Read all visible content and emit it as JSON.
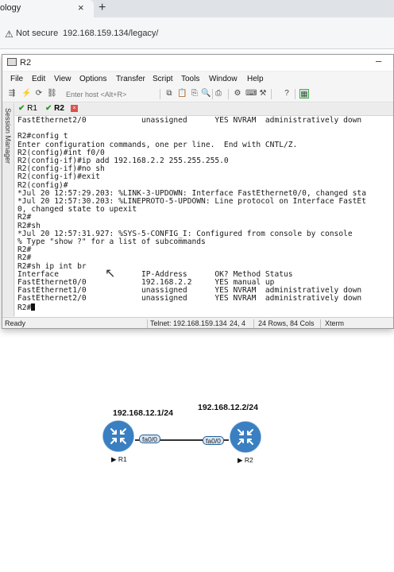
{
  "browser": {
    "tab_title": "ology",
    "tab_close": "×",
    "new_tab": "+",
    "security_label": "Not secure",
    "url": "192.168.159.134/legacy/"
  },
  "window": {
    "title": "R2",
    "minimize": "–"
  },
  "menu": {
    "items": [
      "File",
      "Edit",
      "View",
      "Options",
      "Transfer",
      "Script",
      "Tools",
      "Window",
      "Help"
    ]
  },
  "toolbar": {
    "host_placeholder": "Enter host <Alt+R>"
  },
  "sessions": {
    "side_panel_label": "Session Manager",
    "tabs": [
      {
        "check": "✔",
        "label": "R1"
      },
      {
        "check": "✔",
        "label": "R2"
      }
    ],
    "close": "×"
  },
  "terminal": {
    "lines": [
      "FastEthernet2/0            unassigned      YES NVRAM  administratively down",
      "",
      "R2#config t",
      "Enter configuration commands, one per line.  End with CNTL/Z.",
      "R2(config)#int f0/0",
      "R2(config-if)#ip add 192.168.2.2 255.255.255.0",
      "R2(config-if)#no sh",
      "R2(config-if)#exit",
      "R2(config)#",
      "*Jul 20 12:57:29.203: %LINK-3-UPDOWN: Interface FastEthernet0/0, changed sta",
      "*Jul 20 12:57:30.203: %LINEPROTO-5-UPDOWN: Line protocol on Interface FastEt",
      "0, changed state to upexit",
      "R2#",
      "R2#sh",
      "*Jul 20 12:57:31.927: %SYS-5-CONFIG_I: Configured from console by console",
      "% Type \"show ?\" for a list of subcommands",
      "R2#",
      "R2#",
      "R2#sh ip int br",
      "Interface                  IP-Address      OK? Method Status",
      "FastEthernet0/0            192.168.2.2     YES manual up",
      "FastEthernet1/0            unassigned      YES NVRAM  administratively down",
      "FastEthernet2/0            unassigned      YES NVRAM  administratively down"
    ],
    "prompt": "R2#"
  },
  "statusbar": {
    "ready": "Ready",
    "connection": "Telnet: 192.168.159.134",
    "position": "24,  4",
    "size": "24 Rows, 84 Cols",
    "terminal_type": "Xterm"
  },
  "topology": {
    "r1_ip": "192.168.12.1/24",
    "r2_ip": "192.168.12.2/24",
    "r1_iface": "fa0/0",
    "r2_iface": "fa0/0",
    "r1_name": "▶ R1",
    "r2_name": "▶ R2",
    "router_color": "#3a7fc1"
  }
}
